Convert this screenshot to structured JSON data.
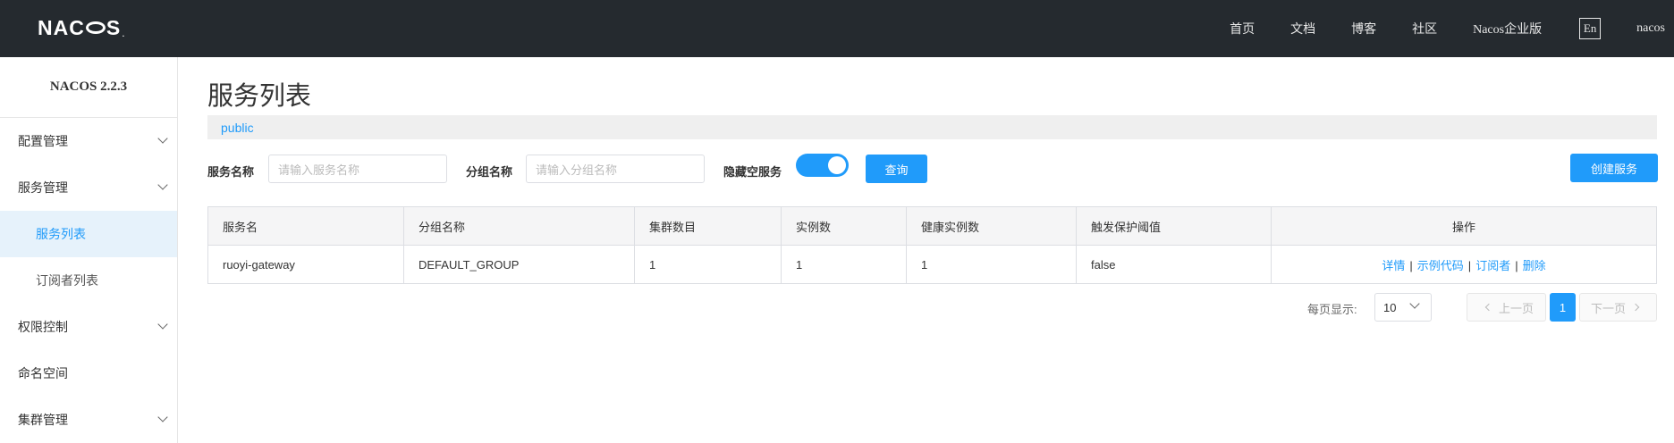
{
  "header": {
    "logo_text": "NACOS.",
    "nav": [
      "首页",
      "文档",
      "博客",
      "社区",
      "Nacos企业版"
    ],
    "lang": "En",
    "user": "nacos"
  },
  "sidebar": {
    "version": "NACOS 2.2.3",
    "items": [
      {
        "label": "配置管理",
        "expandable": true
      },
      {
        "label": "服务管理",
        "expandable": true
      },
      {
        "label": "服务列表",
        "sub": true,
        "active": true
      },
      {
        "label": "订阅者列表",
        "sub": true
      },
      {
        "label": "权限控制",
        "expandable": true
      },
      {
        "label": "命名空间"
      },
      {
        "label": "集群管理",
        "expandable": true
      }
    ]
  },
  "main": {
    "title": "服务列表",
    "namespace": "public",
    "filters": {
      "service_name_label": "服务名称",
      "service_name_placeholder": "请输入服务名称",
      "group_name_label": "分组名称",
      "group_name_placeholder": "请输入分组名称",
      "hide_empty_label": "隐藏空服务",
      "hide_empty_on": true,
      "query_button": "查询",
      "create_button": "创建服务"
    },
    "table": {
      "columns": [
        "服务名",
        "分组名称",
        "集群数目",
        "实例数",
        "健康实例数",
        "触发保护阈值",
        "操作"
      ],
      "rows": [
        {
          "service": "ruoyi-gateway",
          "group": "DEFAULT_GROUP",
          "clusters": "1",
          "instances": "1",
          "healthy": "1",
          "threshold": "false"
        }
      ],
      "actions": [
        "详情",
        "示例代码",
        "订阅者",
        "删除"
      ]
    },
    "pagination": {
      "per_page_label": "每页显示:",
      "per_page_value": "10",
      "prev": "上一页",
      "current": "1",
      "next": "下一页"
    }
  },
  "colors": {
    "topbar": "#252a2f",
    "accent": "#209bfa",
    "active_bg": "#e6f2fb"
  }
}
